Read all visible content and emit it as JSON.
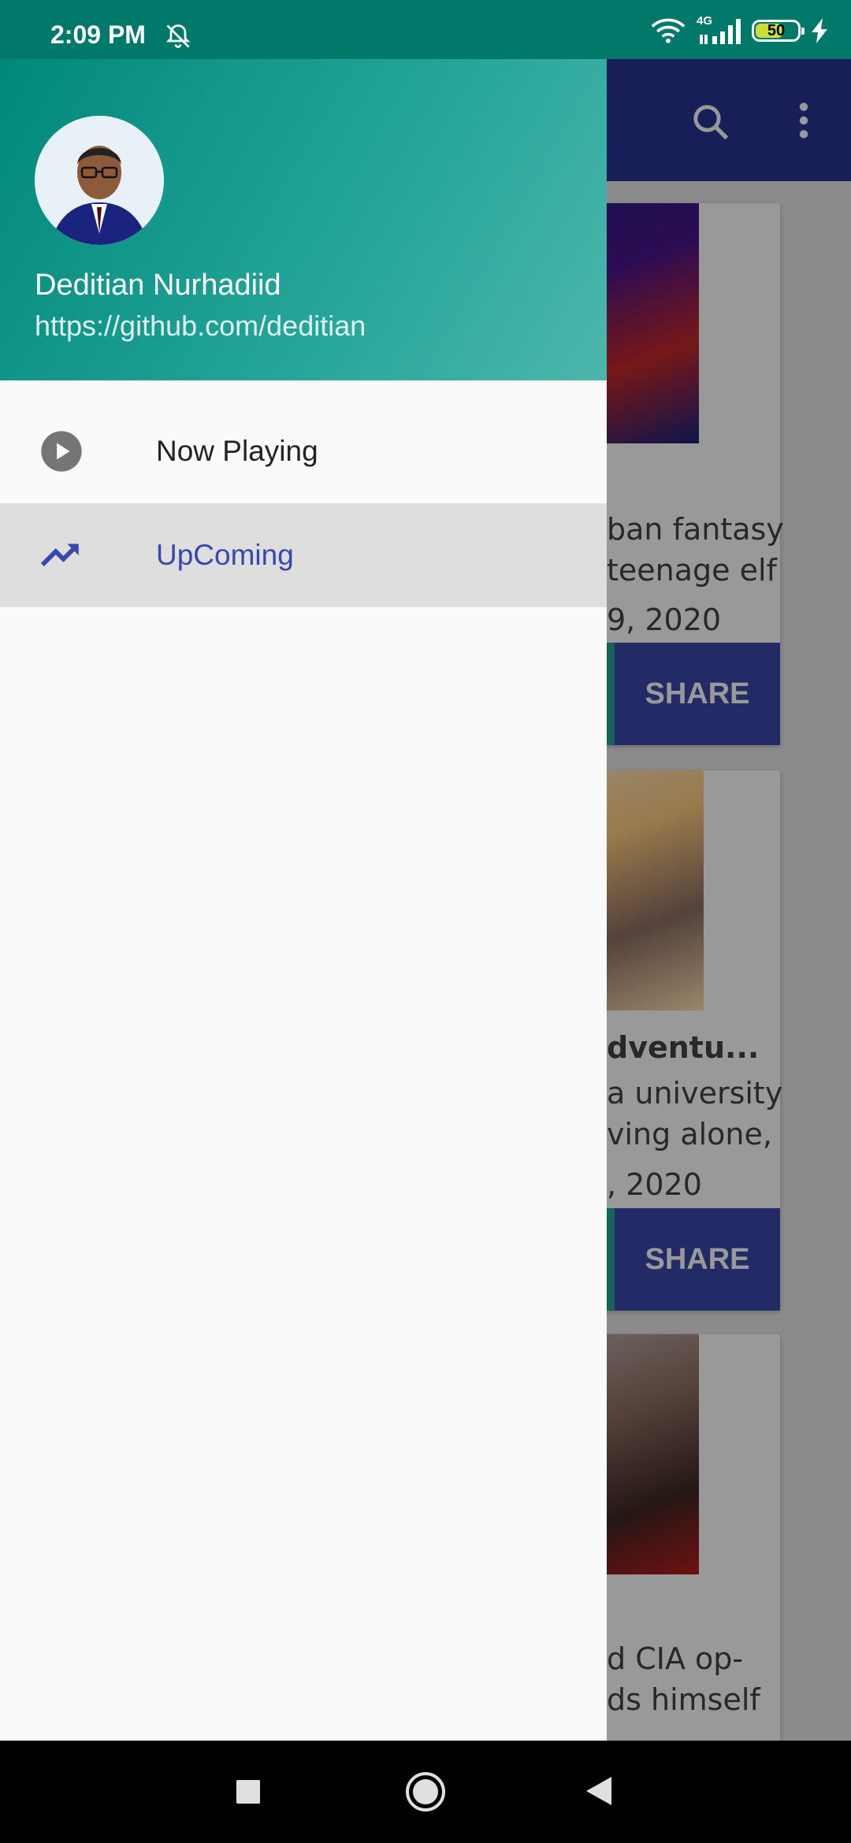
{
  "status_bar": {
    "time": "2:09 PM",
    "network": "4G",
    "battery": "50"
  },
  "background": {
    "cards": [
      {
        "desc": "ban fantasy\nteenage elf",
        "date": "9, 2020",
        "share": "SHARE"
      },
      {
        "title": "dventu...",
        "desc": "a university\nving alone,",
        "date": ", 2020",
        "share": "SHARE"
      },
      {
        "desc": "d CIA op-\nds himself"
      }
    ]
  },
  "drawer": {
    "user_name": "Deditian Nurhadiid",
    "user_link": "https://github.com/deditian",
    "menu": [
      {
        "label": "Now Playing",
        "icon": "play-circle-icon",
        "selected": false
      },
      {
        "label": "UpComing",
        "icon": "trending-up-icon",
        "selected": true
      }
    ]
  },
  "colors": {
    "header": "#00897b",
    "toolbar": "#283593",
    "accent": "#3949ab"
  }
}
